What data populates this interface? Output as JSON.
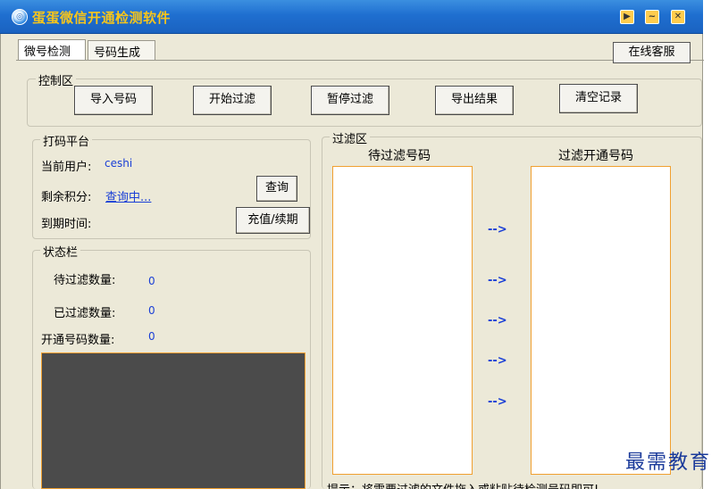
{
  "window": {
    "title": "蛋蛋微信开通检测软件"
  },
  "tabs": [
    {
      "label": "微号检测"
    },
    {
      "label": "号码生成"
    }
  ],
  "toolbar": {
    "online_service": "在线客服"
  },
  "control": {
    "legend": "控制区",
    "buttons": [
      {
        "label": "导入号码"
      },
      {
        "label": "开始过滤"
      },
      {
        "label": "暂停过滤"
      },
      {
        "label": "导出结果"
      },
      {
        "label": "清空记录"
      }
    ]
  },
  "coding": {
    "legend": "打码平台",
    "current_user_label": "当前用户:",
    "current_user_value": "ceshi",
    "points_label": "剩余积分:",
    "points_value": "查询中...",
    "expiry_label": "到期时间:",
    "query_button": "查询",
    "recharge_button": "充值/续期"
  },
  "status": {
    "legend": "状态栏",
    "pending_label": "待过滤数量:",
    "pending_value": "0",
    "filtered_label": "已过滤数量:",
    "filtered_value": "0",
    "opened_label": "开通号码数量:",
    "opened_value": "0"
  },
  "filter": {
    "legend": "过滤区",
    "left_header": "待过滤号码",
    "right_header": "过滤开通号码",
    "arrow": "-->",
    "tip": "提示：将需要过滤的文件拖入或粘贴待检测号码即可!"
  },
  "watermark": "最需教育"
}
